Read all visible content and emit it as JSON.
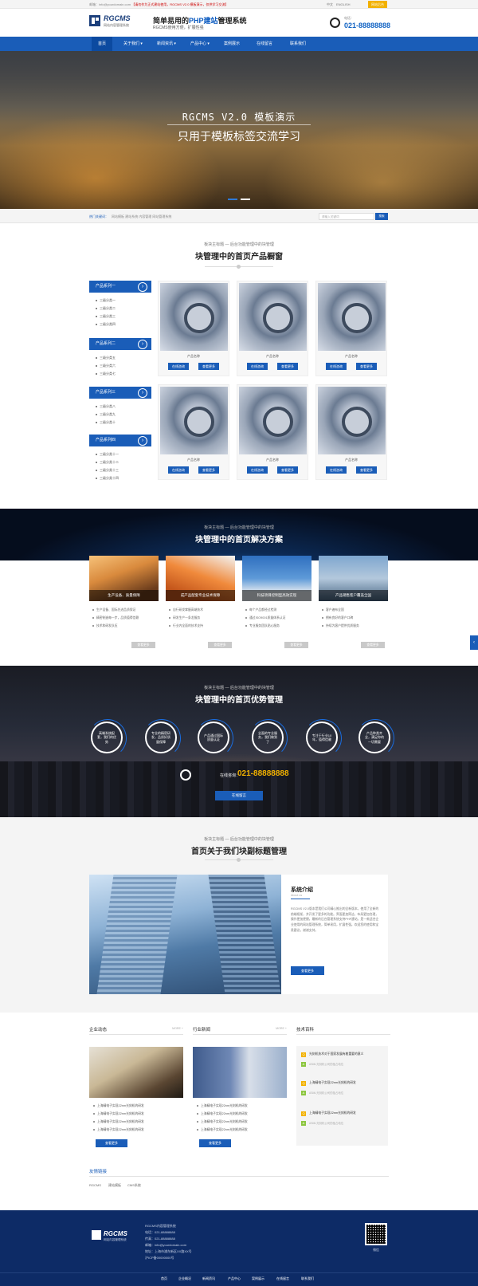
{
  "topbar": {
    "email": "邮箱：info@yourdomain.com",
    "notice": "【请勿作为正式建站使用，RGCMS V2.0 模板演示，仅供学习交流】",
    "lang": "中文　ENGLISH",
    "button": "网站后台"
  },
  "header": {
    "logo_text": "RGCMS",
    "logo_sub": "网站内容管理系统",
    "slogan_a": "简单易用的",
    "slogan_b": "PHP建站",
    "slogan_c": "管理系统",
    "slogan_sub": "RGCMS使用方便，扩展性强",
    "phone_label": "电话：",
    "phone": "021-88888888"
  },
  "nav": [
    "首页",
    "关于我们",
    "新闻资讯",
    "产品中心",
    "案例展示",
    "在线留言",
    "联系我们"
  ],
  "banner": {
    "title": "RGCMS V2.0 模板演示",
    "subtitle": "只用于模板标签交流学习"
  },
  "keywords": {
    "label": "热门关键词：",
    "text": "网站模板  建站系统  内容管理  网站管理系统",
    "search_placeholder": "请输入关键词",
    "search_button": "搜索"
  },
  "products": {
    "sub": "板块主标题 — 后台功能管理中的块管理",
    "title": "块管理中的首页产品橱窗",
    "categories": [
      {
        "name": "产品系列一",
        "items": [
          "三级分类一",
          "三级分类二",
          "三级分类三",
          "三级分类四"
        ]
      },
      {
        "name": "产品系列二",
        "items": [
          "三级分类五",
          "三级分类六",
          "三级分类七"
        ]
      },
      {
        "name": "产品系列三",
        "items": [
          "三级分类八",
          "三级分类九",
          "三级分类十"
        ]
      },
      {
        "name": "产品系列四",
        "items": [
          "三级分类十一",
          "三级分类十二",
          "三级分类十三",
          "三级分类十四"
        ]
      }
    ],
    "item_name": "产品名称",
    "btn_consult": "在线咨询",
    "btn_detail": "查看更多"
  },
  "solutions": {
    "sub": "板块主标题 — 后台功能管理中的块管理",
    "title": "块管理中的首页解决方案",
    "cards": [
      {
        "caption": "生产设备、质量保障",
        "items": [
          "生产设备、国际先进品质保证",
          "精密制造每一步，品质值得信赖",
          "技术和研发队伍"
        ]
      },
      {
        "caption": "成产品配套专业技术保障",
        "items": [
          "自行研发掌握高端技术",
          "研发生产一条龙服务",
          "行业内全面的技术支持"
        ]
      },
      {
        "caption": "科技项目控制型高效实现",
        "items": [
          "每个产品都经过检测",
          "通过ISO9001质量体系认证",
          "专业服务团队贴心服务"
        ]
      },
      {
        "caption": "产品销售客户覆盖全国",
        "items": [
          "客户遍布全国",
          "拥有良好的客户口碑",
          "持续为客户提供优质服务"
        ]
      }
    ],
    "more": "查看更多"
  },
  "advantages": {
    "sub": "板块主标题 — 后台功能管理中的块管理",
    "title": "块管理中的首页优势管理",
    "circles": [
      "高端系统配套，我们的优势",
      "专业的精密研发，品质好质量保障",
      "产品通过国际质量认证",
      "全面的专业服务，我们做到了",
      "专注于行业10年，值得信赖",
      "产品种类齐全，满足你的一切需要"
    ],
    "phone_label": "在线咨询：",
    "phone": "021-88888888",
    "button": "在线留言"
  },
  "about": {
    "sub": "板块主标题 — 后台功能管理中的块管理",
    "title": "首页关于我们块副标题管理",
    "heading": "系统介绍",
    "heading_en": "About us",
    "text": "RGCMS V2.0版本是我们公司精心推出的全新版本，使用了全新的前端框架，并开发了更多的功能。界面更加简洁，布局更加合理，操作更加便捷。最新的后台管理系统支持PHP建站，是一款适合企业使用的网站管理系统，简单易用，扩展性强。欢迎您的使用和宝贵建议，谢谢支持。",
    "button": "查看更多"
  },
  "news": {
    "col1": {
      "title": "企业动态",
      "more": "MORE +",
      "items": [
        "上海精电子实现22nm光刻机的研发",
        "上海精电子实现22nm光刻机的研发",
        "上海精电子实现22nm光刻机的研发",
        "上海精电子实现22nm光刻机的研发"
      ],
      "button": "查看更多"
    },
    "col2": {
      "title": "行业新闻",
      "more": "MORE +",
      "items": [
        "上海精电子实现22nm光刻机的研发",
        "上海精电子实现22nm光刻机的研发",
        "上海精电子实现22nm光刻机的研发",
        "上海精电子实现22nm光刻机的研发"
      ],
      "button": "查看更多"
    },
    "col3": {
      "title": "技术百科",
      "qa": [
        {
          "q": "光刻机技术对于国家发展有着重要的意义",
          "a": "ASML光刻机公司的独占地位"
        },
        {
          "q": "上海精电子实现22nm光刻机的研发",
          "a": "ASML光刻机公司的独占地位"
        },
        {
          "q": "上海精电子实现22nm光刻机的研发",
          "a": "ASML光刻机公司的独占地位"
        }
      ]
    }
  },
  "links": {
    "title": "友情链接",
    "items": [
      "RGCMS",
      "建站模板",
      "CMS系统"
    ]
  },
  "footer": {
    "logo_text": "RGCMS",
    "logo_sub": "网站内容管理系统",
    "info": [
      "RGCMS内容管理系统",
      "电话：021-88888888",
      "传真：021-88888888",
      "邮箱：info@yourdomain.com",
      "地址：上海市浦东新区XX路XX号",
      "沪ICP备00000000号"
    ],
    "qr_label": "微信",
    "nav": [
      "首页",
      "企业概况",
      "新闻资讯",
      "产品中心",
      "案例展示",
      "在线留言",
      "联系我们"
    ]
  }
}
